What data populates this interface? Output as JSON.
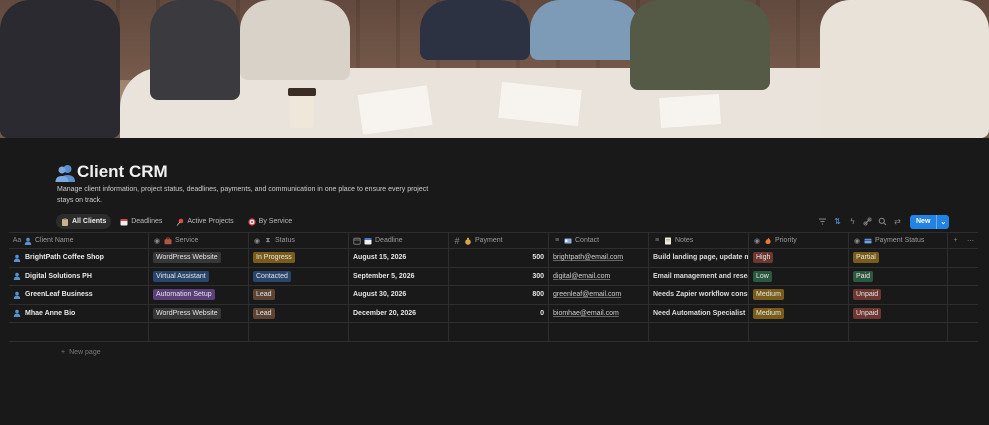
{
  "page": {
    "title": "Client CRM",
    "description": "Manage client information, project status, deadlines, payments, and communication in one place to ensure every project stays on track.",
    "icon": "people-icon"
  },
  "tabs": [
    {
      "label": "All Clients",
      "icon": "clipboard-icon",
      "active": true
    },
    {
      "label": "Deadlines",
      "icon": "calendar-icon",
      "active": false
    },
    {
      "label": "Active Projects",
      "icon": "pushpin-icon",
      "active": false
    },
    {
      "label": "By Service",
      "icon": "target-icon",
      "active": false
    }
  ],
  "toolbar": {
    "icons": [
      "filter-icon",
      "sort-icon",
      "lightning-icon",
      "link-icon",
      "search-icon",
      "settings-icon"
    ],
    "new_label": "New"
  },
  "columns": [
    {
      "label": "Client Name",
      "type_icon": "text-type-icon",
      "emoji": "person-icon"
    },
    {
      "label": "Service",
      "type_icon": "select-type-icon",
      "emoji": "briefcase-icon"
    },
    {
      "label": "Status",
      "type_icon": "select-type-icon",
      "emoji": "hourglass-icon"
    },
    {
      "label": "Deadline",
      "type_icon": "date-type-icon",
      "emoji": "calendar-icon"
    },
    {
      "label": "Payment",
      "type_icon": "number-type-icon",
      "emoji": "moneybag-icon"
    },
    {
      "label": "Contact",
      "type_icon": "text-type-icon",
      "emoji": "id-card-icon"
    },
    {
      "label": "Notes",
      "type_icon": "text-type-icon",
      "emoji": "memo-icon"
    },
    {
      "label": "Priority",
      "type_icon": "select-type-icon",
      "emoji": "fire-icon"
    },
    {
      "label": "Payment Status",
      "type_icon": "select-type-icon",
      "emoji": "card-icon"
    }
  ],
  "rows": [
    {
      "name": "BrightPath Coffee Shop",
      "service": "WordPress Website",
      "status": "In Progress",
      "deadline": "August 15, 2026",
      "payment": "500",
      "contact": "brightpath@email.com",
      "notes": "Build landing page, update menu",
      "priority": "High",
      "payment_status": "Partial"
    },
    {
      "name": "Digital Solutions PH",
      "service": "Virtual Assistant",
      "status": "Contacted",
      "deadline": "September 5, 2026",
      "payment": "300",
      "contact": "digital@email.com",
      "notes": "Email management and research",
      "priority": "Low",
      "payment_status": "Paid"
    },
    {
      "name": "GreenLeaf Business",
      "service": "Automation Setup",
      "status": "Lead",
      "deadline": "August 30, 2026",
      "payment": "800",
      "contact": "greenleaf@email.com",
      "notes": "Needs Zapier workflow consultation",
      "priority": "Medium",
      "payment_status": "Unpaid"
    },
    {
      "name": "Mhae Anne Bio",
      "service": "WordPress Website",
      "status": "Lead",
      "deadline": "December 20, 2026",
      "payment": "0",
      "contact": "biomhae@email.com",
      "notes": "Need Automation Specialist",
      "priority": "Medium",
      "payment_status": "Unpaid"
    }
  ],
  "colors": {
    "service": {
      "WordPress Website": "#373737",
      "Virtual Assistant": "#28456c",
      "Automation Setup": "#5a3f78"
    },
    "status": {
      "In Progress": "#7a5c1a",
      "Contacted": "#28456c",
      "Lead": "#5b4433"
    },
    "priority": {
      "High": "#6e3630",
      "Low": "#2b593f",
      "Medium": "#7a5c1a"
    },
    "payment_status": {
      "Partial": "#7a5c1a",
      "Paid": "#2b593f",
      "Unpaid": "#6e3630"
    },
    "accent": "#2383e2"
  },
  "footer": {
    "new_page_label": "New page"
  }
}
